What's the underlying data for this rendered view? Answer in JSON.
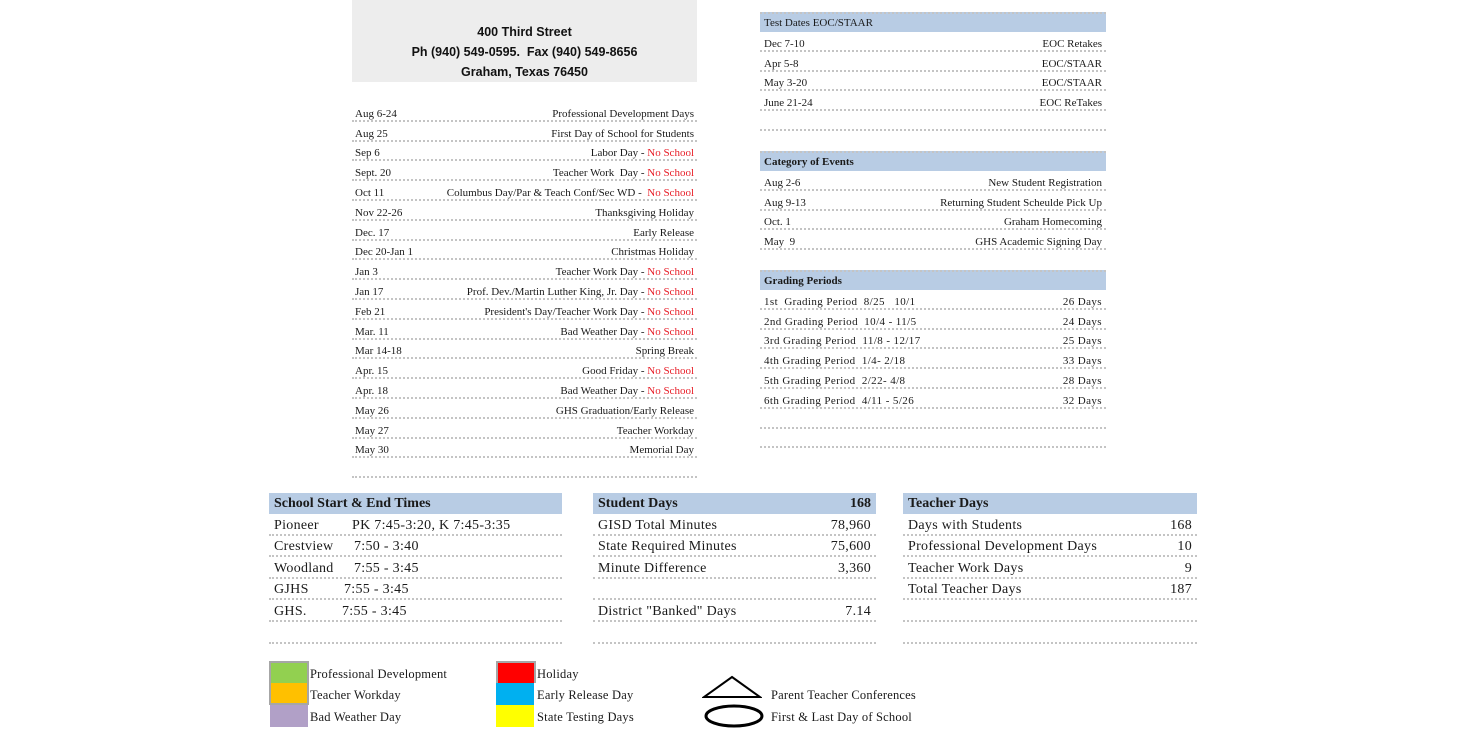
{
  "header": {
    "address_line1": "400 Third Street",
    "address_line2": "Ph (940) 549-0595.  Fax (940) 549-8656",
    "address_line3": "Graham, Texas 76450"
  },
  "events": [
    {
      "date": "Aug 6-24",
      "desc": "Professional Development Days",
      "note": ""
    },
    {
      "date": "Aug 25",
      "desc": "First Day of School for Students",
      "note": ""
    },
    {
      "date": "Sep 6",
      "desc": "Labor Day - ",
      "note": "No School"
    },
    {
      "date": "Sept. 20",
      "desc": "Teacher Work  Day - ",
      "note": "No School"
    },
    {
      "date": "Oct 11",
      "desc": "Columbus Day/Par & Teach Conf/Sec WD -  ",
      "note": "No School"
    },
    {
      "date": "Nov 22-26",
      "desc": "Thanksgiving Holiday",
      "note": ""
    },
    {
      "date": "Dec. 17",
      "desc": "Early Release",
      "note": ""
    },
    {
      "date": "Dec 20-Jan 1",
      "desc": "Christmas Holiday",
      "note": ""
    },
    {
      "date": "Jan 3",
      "desc": "Teacher Work Day - ",
      "note": "No School"
    },
    {
      "date": "Jan 17",
      "desc": "Prof. Dev./Martin Luther King, Jr. Day - ",
      "note": "No School"
    },
    {
      "date": "Feb 21",
      "desc": "President's Day/Teacher Work Day - ",
      "note": "No School"
    },
    {
      "date": "Mar. 11",
      "desc": "Bad Weather Day - ",
      "note": "No School"
    },
    {
      "date": "Mar 14-18",
      "desc": "Spring Break",
      "note": ""
    },
    {
      "date": "Apr. 15",
      "desc": "Good Friday - ",
      "note": "No School"
    },
    {
      "date": "Apr. 18",
      "desc": "Bad Weather Day - ",
      "note": "No School"
    },
    {
      "date": "May 26",
      "desc": "GHS Graduation/Early Release",
      "note": ""
    },
    {
      "date": "May 27",
      "desc": "Teacher Workday",
      "note": ""
    },
    {
      "date": "May 30",
      "desc": "Memorial Day",
      "note": ""
    }
  ],
  "test_dates": {
    "title": "Test Dates EOC/STAAR",
    "rows": [
      {
        "date": "Dec 7-10",
        "desc": "EOC Retakes"
      },
      {
        "date": "Apr 5-8",
        "desc": "EOC/STAAR"
      },
      {
        "date": "May 3-20",
        "desc": "EOC/STAAR"
      },
      {
        "date": "June 21-24",
        "desc": "EOC ReTakes"
      }
    ]
  },
  "category_events": {
    "title": "Category of Events",
    "rows": [
      {
        "date": "Aug 2-6",
        "desc": "New Student Registration"
      },
      {
        "date": "Aug 9-13",
        "desc": "Returning Student Scheulde Pick Up"
      },
      {
        "date": "Oct. 1",
        "desc": "Graham Homecoming"
      },
      {
        "date": "May  9",
        "desc": "GHS Academic Signing Day"
      }
    ]
  },
  "grading_periods": {
    "title": "Grading Periods",
    "rows": [
      {
        "period": "1st  Grading Period  8/25   10/1",
        "days": "26 Days"
      },
      {
        "period": "2nd Grading Period  10/4 - 11/5",
        "days": "24 Days"
      },
      {
        "period": "3rd Grading Period  11/8 - 12/17",
        "days": "25 Days"
      },
      {
        "period": "4th Grading Period  1/4- 2/18",
        "days": "33 Days"
      },
      {
        "period": "5th Grading Period  2/22- 4/8",
        "days": "28 Days"
      },
      {
        "period": "6th Grading Period  4/11 - 5/26",
        "days": "32 Days"
      }
    ]
  },
  "school_times": {
    "title": "School Start & End Times",
    "rows": [
      {
        "school": "Pioneer",
        "times": "PK 7:45-3:20, K 7:45-3:35"
      },
      {
        "school": "Crestview",
        "times": "7:50 - 3:40"
      },
      {
        "school": "Woodland",
        "times": "7:55 - 3:45"
      },
      {
        "school": "GJHS",
        "times": "7:55 - 3:45"
      },
      {
        "school": "GHS.",
        "times": "7:55 - 3:45"
      }
    ]
  },
  "student_days": {
    "title": "Student Days",
    "title_value": "168",
    "rows": [
      {
        "label": "GISD Total Minutes",
        "value": "78,960"
      },
      {
        "label": "State Required Minutes",
        "value": "75,600"
      },
      {
        "label": "Minute Difference",
        "value": "3,360"
      }
    ],
    "banked_label": "District \"Banked\" Days",
    "banked_value": "7.14"
  },
  "teacher_days": {
    "title": "Teacher Days",
    "rows": [
      {
        "label": "Days with Students",
        "value": "168"
      },
      {
        "label": "Professional Development Days",
        "value": "10"
      },
      {
        "label": "Teacher Work Days",
        "value": "9"
      },
      {
        "label": "Total Teacher Days",
        "value": "187"
      }
    ]
  },
  "legend": {
    "items": [
      {
        "label": "Professional Development",
        "color": "#92d050"
      },
      {
        "label": "Teacher Workday",
        "color": "#ffc000"
      },
      {
        "label": "Bad Weather Day",
        "color": "#b1a0c7"
      },
      {
        "label": "Holiday",
        "color": "#ff0000"
      },
      {
        "label": "Early Release Day",
        "color": "#00b0f0"
      },
      {
        "label": "State Testing Days",
        "color": "#ffff00"
      }
    ],
    "symbols": [
      {
        "label": "Parent Teacher Conferences",
        "icon": "triangle-icon"
      },
      {
        "label": "First & Last Day of School",
        "icon": "oval-icon"
      }
    ]
  },
  "colors": {
    "header_fill": "#b8cce4",
    "no_school_red": "#e8202a",
    "address_box": "#ededed"
  }
}
